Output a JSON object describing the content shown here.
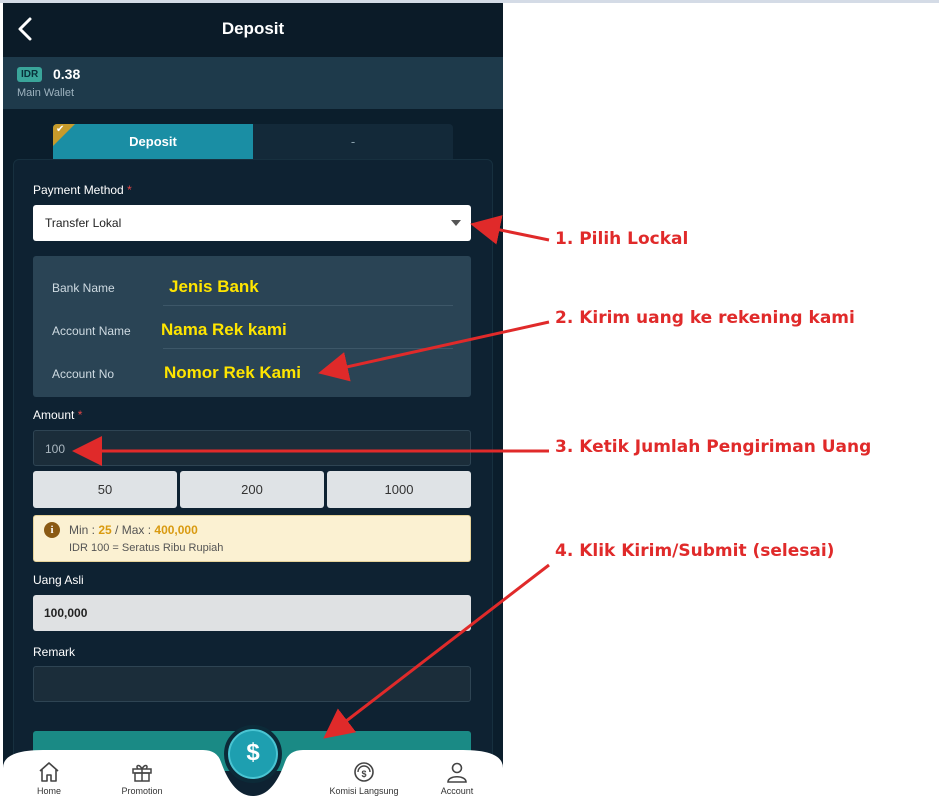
{
  "header": {
    "title": "Deposit"
  },
  "wallet": {
    "currency": "IDR",
    "amount": "0.38",
    "label": "Main Wallet"
  },
  "tabs": [
    {
      "label": "Deposit"
    },
    {
      "label": "-"
    }
  ],
  "form": {
    "payment_method_label": "Payment Method",
    "required_mark": "*",
    "payment_method_value": "Transfer Lokal",
    "bank": [
      {
        "label": "Bank Name",
        "value": "Jenis Bank"
      },
      {
        "label": "Account Name",
        "value": "Nama Rek kami"
      },
      {
        "label": "Account No",
        "value": "Nomor Rek Kami"
      }
    ],
    "amount_label": "Amount",
    "amount_value": "100",
    "quick_amounts": [
      "50",
      "200",
      "1000"
    ],
    "notice": {
      "min_label": "Min : ",
      "min_value": "25",
      "sep": " / Max : ",
      "max_value": "400,000",
      "line2": "IDR 100 = Seratus Ribu Rupiah"
    },
    "real_money_label": "Uang Asli",
    "real_money_value": "100,000",
    "remark_label": "Remark",
    "remark_value": ""
  },
  "fab_icon": "dollar-icon",
  "fab_symbol": "$",
  "nav": [
    {
      "label": "Home",
      "icon": "home-icon"
    },
    {
      "label": "Promotion",
      "icon": "gift-icon"
    },
    {
      "label": "Komisi Langsung",
      "icon": "commission-icon"
    },
    {
      "label": "Account",
      "icon": "user-icon"
    }
  ],
  "annotations": [
    "1. Pilih Lockal",
    "2. Kirim uang ke rekening kami",
    "3. Ketik Jumlah Pengiriman Uang",
    "4. Klik Kirim/Submit (selesai)"
  ],
  "colors": {
    "annotation": "#e02a2a",
    "highlight_text": "#ffe500",
    "accent": "#1a8ea4"
  }
}
